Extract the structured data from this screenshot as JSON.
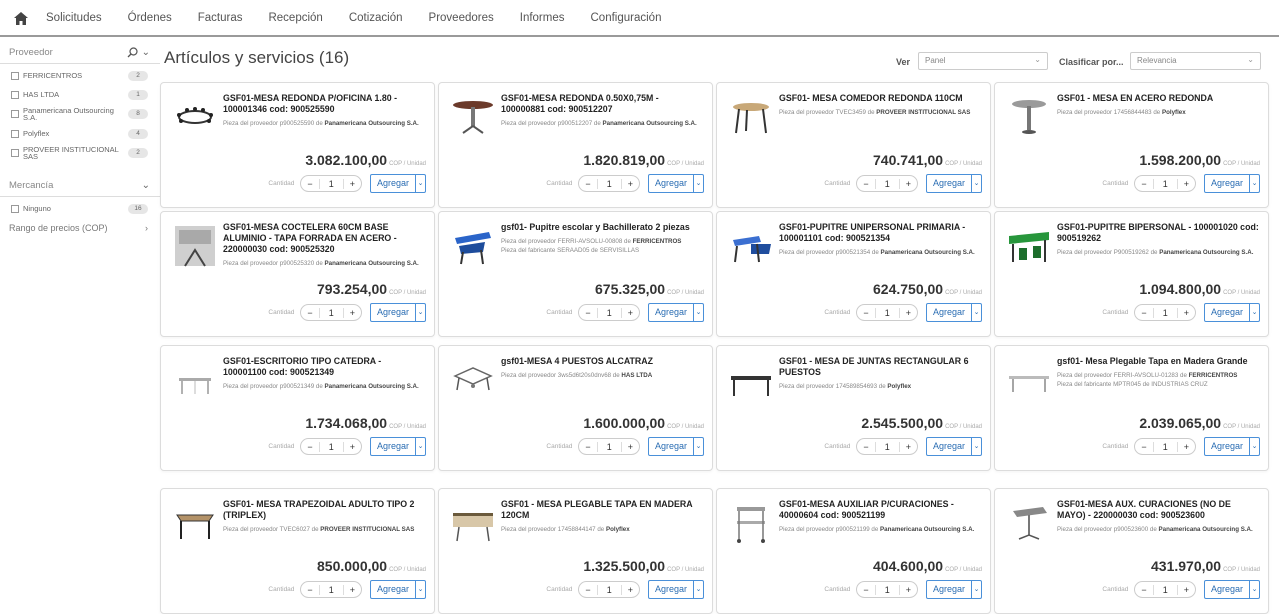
{
  "nav": {
    "items": [
      "Solicitudes",
      "Órdenes",
      "Facturas",
      "Recepción",
      "Cotización",
      "Proveedores",
      "Informes",
      "Configuración"
    ]
  },
  "sidebar": {
    "proveedor_label": "Proveedor",
    "proveedores": [
      {
        "label": "FERRICENTROS",
        "count": "2"
      },
      {
        "label": "HAS LTDA",
        "count": "1"
      },
      {
        "label": "Panamericana Outsourcing S.A.",
        "count": "8"
      },
      {
        "label": "Polyflex",
        "count": "4"
      },
      {
        "label": "PROVEER INSTITUCIONAL SAS",
        "count": "2"
      }
    ],
    "mercancia_label": "Mercancía",
    "mercancias": [
      {
        "label": "Ninguno",
        "count": "16"
      }
    ],
    "precio_label": "Rango de precios (COP)"
  },
  "header": {
    "title": "Artículos y servicios (16)",
    "ver_label": "Ver",
    "ver_value": "Panel",
    "clasificar_label": "Clasificar por...",
    "clasificar_value": "Relevancia"
  },
  "common": {
    "unit": "COP / Unidad",
    "qty_label": "Cantidad",
    "qty": "1",
    "add": "Agregar"
  },
  "products": [
    {
      "title": "GSF01-MESA REDONDA P/OFICINA 1.80 - 100001346 cod: 900525590",
      "sub": "Pieza del proveedor p900525590 de",
      "supplier": "Panamericana Outsourcing S.A.",
      "extra": "",
      "price": "3.082.100,00",
      "icon": "round-table-icon"
    },
    {
      "title": "GSF01-MESA REDONDA 0.50X0,75M - 100000881 cod: 900512207",
      "sub": "Pieza del proveedor p900512207 de",
      "supplier": "Panamericana Outsourcing S.A.",
      "extra": "",
      "price": "1.820.819,00",
      "icon": "pedestal-table-icon"
    },
    {
      "title": "GSF01- MESA COMEDOR REDONDA 110CM",
      "sub": "Pieza del proveedor TVEC3459 de",
      "supplier": "PROVEER INSTITUCIONAL SAS",
      "extra": "",
      "price": "740.741,00",
      "icon": "dining-table-icon"
    },
    {
      "title": "GSF01 - MESA EN ACERO REDONDA",
      "sub": "Pieza del proveedor 17456844483 de",
      "supplier": "Polyflex",
      "extra": "",
      "price": "1.598.200,00",
      "icon": "steel-table-icon"
    },
    {
      "title": "GSF01-MESA COCTELERA 60CM BASE ALUMINIO - TAPA FORRADA EN ACERO - 220000030 cod: 900525320",
      "sub": "Pieza del proveedor p900525320 de",
      "supplier": "Panamericana Outsourcing S.A.",
      "extra": "",
      "price": "793.254,00",
      "icon": "cocktail-table-icon"
    },
    {
      "title": "gsf01- Pupitre escolar y Bachillerato 2 piezas",
      "sub": "Pieza del proveedor FERRI-AVSOLU-00808 de",
      "supplier": "FERRICENTROS",
      "extra": "Pieza del fabricante SERAAD05 de SERVISILLAS",
      "price": "675.325,00",
      "icon": "school-desk-icon"
    },
    {
      "title": "GSF01-PUPITRE UNIPERSONAL PRIMARIA - 100001101 cod: 900521354",
      "sub": "Pieza del proveedor p900521354 de",
      "supplier": "Panamericana Outsourcing S.A.",
      "extra": "",
      "price": "624.750,00",
      "icon": "single-desk-icon"
    },
    {
      "title": "GSF01-PUPITRE BIPERSONAL - 100001020 cod: 900519262",
      "sub": "Pieza del proveedor P900519262 de",
      "supplier": "Panamericana Outsourcing S.A.",
      "extra": "",
      "price": "1.094.800,00",
      "icon": "double-desk-icon"
    },
    {
      "title": "GSF01-ESCRITORIO TIPO CATEDRA - 100001100 cod: 900521349",
      "sub": "Pieza del proveedor p900521349 de",
      "supplier": "Panamericana Outsourcing S.A.",
      "extra": "",
      "price": "1.734.068,00",
      "icon": "lectern-desk-icon"
    },
    {
      "title": "gsf01-MESA 4 PUESTOS ALCATRAZ",
      "sub": "Pieza del proveedor 3ws5d6t20s0dnv68 de",
      "supplier": "HAS LTDA",
      "extra": "",
      "price": "1.600.000,00",
      "icon": "four-seat-table-icon"
    },
    {
      "title": "GSF01 - MESA DE JUNTAS RECTANGULAR 6 PUESTOS",
      "sub": "Pieza del proveedor 174589854693 de",
      "supplier": "Polyflex",
      "extra": "",
      "price": "2.545.500,00",
      "icon": "meeting-table-icon"
    },
    {
      "title": "gsf01- Mesa Plegable Tapa en Madera Grande",
      "sub": "Pieza del proveedor FERRI-AVSOLU-01283 de",
      "supplier": "FERRICENTROS",
      "extra": "Pieza del fabricante MPTR045 de INDUSTRIAS CRUZ",
      "price": "2.039.065,00",
      "icon": "folding-table-icon"
    },
    {
      "title": "GSF01- MESA TRAPEZOIDAL ADULTO TIPO 2 (TRIPLEX)",
      "sub": "Pieza del proveedor TVEC6027 de",
      "supplier": "PROVEER INSTITUCIONAL SAS",
      "extra": "",
      "price": "850.000,00",
      "icon": "trapezoid-table-icon"
    },
    {
      "title": "GSF01 - MESA PLEGABLE TAPA EN MADERA 120CM",
      "sub": "Pieza del proveedor 17458844147 de",
      "supplier": "Polyflex",
      "extra": "",
      "price": "1.325.500,00",
      "icon": "folding-wood-table-icon"
    },
    {
      "title": "GSF01-MESA AUXILIAR P/CURACIONES - 40000604 cod: 900521199",
      "sub": "Pieza del proveedor p900521199 de",
      "supplier": "Panamericana Outsourcing S.A.",
      "extra": "",
      "price": "404.600,00",
      "icon": "medical-cart-icon"
    },
    {
      "title": "GSF01-MESA AUX. CURACIONES (NO DE MAYO) - 220000030 cod: 900523600",
      "sub": "Pieza del proveedor p900523600 de",
      "supplier": "Panamericana Outsourcing S.A.",
      "extra": "",
      "price": "431.970,00",
      "icon": "mayo-table-icon"
    }
  ]
}
